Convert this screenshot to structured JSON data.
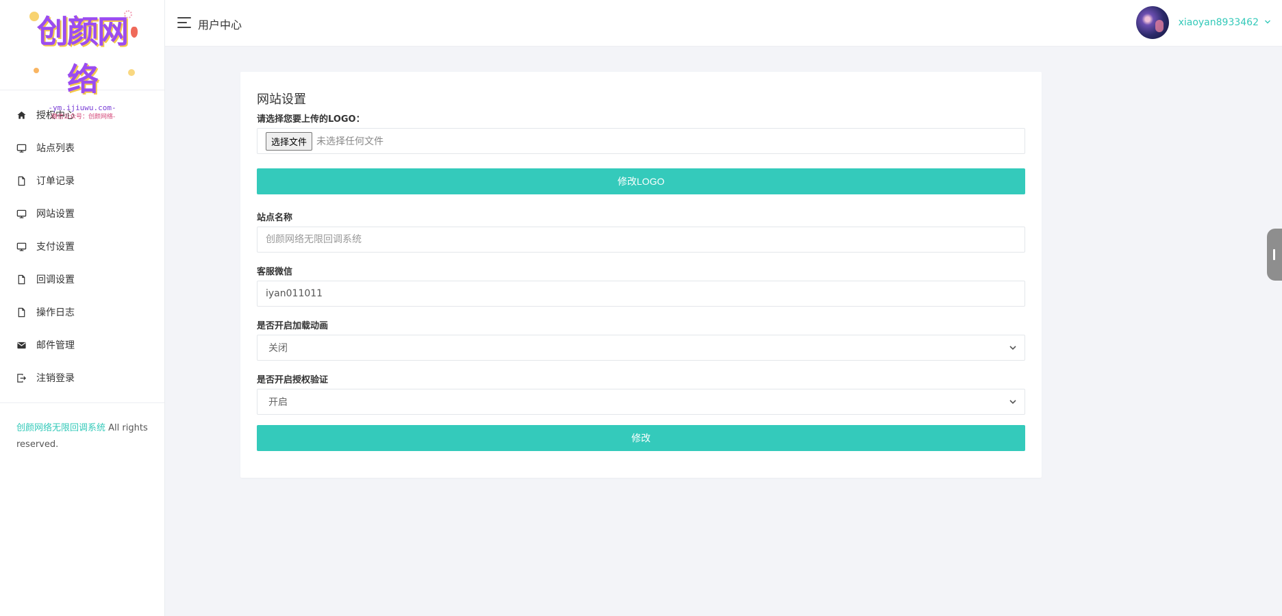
{
  "logo": {
    "main": "创颜网络",
    "url": "-ym.ijiuwu.com-",
    "sub": "-微信公众号：创颜网络-"
  },
  "sidebar": {
    "items": [
      {
        "label": "授权中心",
        "icon": "home-icon"
      },
      {
        "label": "站点列表",
        "icon": "monitor-icon"
      },
      {
        "label": "订单记录",
        "icon": "file-icon"
      },
      {
        "label": "网站设置",
        "icon": "monitor-icon"
      },
      {
        "label": "支付设置",
        "icon": "monitor-icon"
      },
      {
        "label": "回调设置",
        "icon": "file-icon"
      },
      {
        "label": "操作日志",
        "icon": "file-icon"
      },
      {
        "label": "邮件管理",
        "icon": "mail-icon"
      },
      {
        "label": "注销登录",
        "icon": "logout-icon"
      }
    ],
    "footer": {
      "link": "创颜网络无限回调系统",
      "text": " All rights reserved."
    }
  },
  "header": {
    "title": "用户中心",
    "username": "xiaoyan8933462"
  },
  "card": {
    "title": "网站设置",
    "logo_label": "请选择您要上传的LOGO：",
    "file_button": "选择文件",
    "file_status": "未选择任何文件",
    "logo_button": "修改LOGO",
    "site_name_label": "站点名称",
    "site_name_placeholder": "创颜网络无限回调系统",
    "wechat_label": "客服微信",
    "wechat_value": "iyan011011",
    "loading_label": "是否开启加载动画",
    "loading_value": "关闭",
    "auth_label": "是否开启授权验证",
    "auth_value": "开启",
    "submit_button": "修改"
  },
  "colors": {
    "accent": "#34cabb",
    "link": "#33c9b9",
    "background": "#f3f4f8"
  }
}
